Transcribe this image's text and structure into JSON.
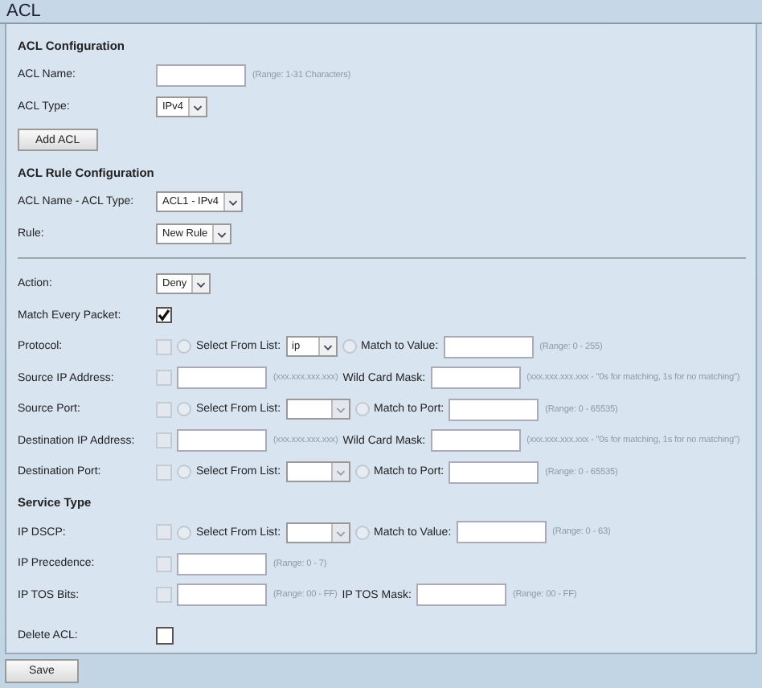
{
  "title": "ACL",
  "rows": [
    {
      "kind": "heading",
      "text": "ACL Configuration"
    },
    {
      "kind": "field",
      "label": "ACL Name:",
      "parts": [
        {
          "kind": "input"
        },
        {
          "kind": "hint",
          "text": "(Range: 1-31 Characters)"
        }
      ]
    },
    {
      "kind": "field",
      "label": "ACL Type:",
      "parts": [
        {
          "kind": "select",
          "value": "IPv4",
          "disabled": false
        }
      ]
    },
    {
      "kind": "button",
      "text": "Add ACL"
    },
    {
      "kind": "heading",
      "text": "ACL Rule Configuration"
    },
    {
      "kind": "field",
      "label": "ACL Name - ACL Type:",
      "parts": [
        {
          "kind": "select",
          "value": "ACL1 - IPv4",
          "disabled": false
        }
      ]
    },
    {
      "kind": "field",
      "label": "Rule:",
      "parts": [
        {
          "kind": "select",
          "value": "New Rule",
          "disabled": false
        }
      ]
    },
    {
      "kind": "rule"
    },
    {
      "kind": "field",
      "label": "Action:",
      "parts": [
        {
          "kind": "select",
          "value": "Deny",
          "disabled": false
        }
      ]
    },
    {
      "kind": "field",
      "label": "Match Every Packet:",
      "parts": [
        {
          "kind": "checkbox",
          "checked": true,
          "disabled": false
        }
      ]
    },
    {
      "kind": "field",
      "label": "Protocol:",
      "parts": [
        {
          "kind": "checkbox",
          "checked": false,
          "disabled": true
        },
        {
          "kind": "radio",
          "selected": false
        },
        {
          "kind": "text",
          "text": "Select From List:"
        },
        {
          "kind": "select",
          "value": "ip",
          "disabled": false
        },
        {
          "kind": "radio",
          "selected": false
        },
        {
          "kind": "text",
          "text": "Match to Value:"
        },
        {
          "kind": "input"
        },
        {
          "kind": "hint",
          "text": "(Range: 0 - 255)"
        }
      ]
    },
    {
      "kind": "field",
      "label": "Source IP Address:",
      "parts": [
        {
          "kind": "checkbox",
          "checked": false,
          "disabled": true
        },
        {
          "kind": "input"
        },
        {
          "kind": "hint",
          "text": "(xxx.xxx.xxx.xxx)"
        },
        {
          "kind": "text",
          "text": "Wild Card Mask:"
        },
        {
          "kind": "input"
        },
        {
          "kind": "hint",
          "text": "(xxx.xxx.xxx.xxx - \"0s for matching, 1s for no matching\")"
        }
      ]
    },
    {
      "kind": "field",
      "label": "Source Port:",
      "parts": [
        {
          "kind": "checkbox",
          "checked": false,
          "disabled": true
        },
        {
          "kind": "radio",
          "selected": false
        },
        {
          "kind": "text",
          "text": "Select From List:"
        },
        {
          "kind": "select",
          "disabled": true
        },
        {
          "kind": "radio",
          "selected": false
        },
        {
          "kind": "text",
          "text": "Match to Port:"
        },
        {
          "kind": "input"
        },
        {
          "kind": "hint",
          "text": "(Range: 0 - 65535)"
        }
      ]
    },
    {
      "kind": "field",
      "label": "Destination IP Address:",
      "parts": [
        {
          "kind": "checkbox",
          "checked": false,
          "disabled": true
        },
        {
          "kind": "input"
        },
        {
          "kind": "hint",
          "text": "(xxx.xxx.xxx.xxx)"
        },
        {
          "kind": "text",
          "text": "Wild Card Mask:"
        },
        {
          "kind": "input"
        },
        {
          "kind": "hint",
          "text": "(xxx.xxx.xxx.xxx - \"0s for matching, 1s for no matching\")"
        }
      ]
    },
    {
      "kind": "field",
      "label": "Destination Port:",
      "parts": [
        {
          "kind": "checkbox",
          "checked": false,
          "disabled": true
        },
        {
          "kind": "radio",
          "selected": false
        },
        {
          "kind": "text",
          "text": "Select From List:"
        },
        {
          "kind": "select",
          "disabled": true
        },
        {
          "kind": "radio",
          "selected": false
        },
        {
          "kind": "text",
          "text": "Match to Port:"
        },
        {
          "kind": "input"
        },
        {
          "kind": "hint",
          "text": "(Range: 0 - 65535)"
        }
      ]
    },
    {
      "kind": "heading",
      "text": "Service Type"
    },
    {
      "kind": "field",
      "label": "IP DSCP:",
      "parts": [
        {
          "kind": "checkbox",
          "checked": false,
          "disabled": true
        },
        {
          "kind": "radio",
          "selected": false
        },
        {
          "kind": "text",
          "text": "Select From List:"
        },
        {
          "kind": "select",
          "disabled": true
        },
        {
          "kind": "radio",
          "selected": false
        },
        {
          "kind": "text",
          "text": "Match to Value:"
        },
        {
          "kind": "input"
        },
        {
          "kind": "hint",
          "text": "(Range: 0 - 63)"
        }
      ]
    },
    {
      "kind": "field",
      "label": "IP Precedence:",
      "parts": [
        {
          "kind": "checkbox",
          "checked": false,
          "disabled": true
        },
        {
          "kind": "input"
        },
        {
          "kind": "hint",
          "text": "(Range: 0 - 7)"
        }
      ]
    },
    {
      "kind": "field",
      "label": "IP TOS Bits:",
      "parts": [
        {
          "kind": "checkbox",
          "checked": false,
          "disabled": true
        },
        {
          "kind": "input"
        },
        {
          "kind": "hint",
          "text": "(Range: 00 - FF)"
        },
        {
          "kind": "text",
          "text": "IP TOS Mask:"
        },
        {
          "kind": "input"
        },
        {
          "kind": "hint",
          "text": "(Range: 00 - FF)"
        }
      ]
    },
    {
      "kind": "field",
      "label": "Delete ACL:",
      "parts": [
        {
          "kind": "checkbox",
          "checked": false,
          "disabled": false
        }
      ]
    }
  ],
  "save": "Save"
}
